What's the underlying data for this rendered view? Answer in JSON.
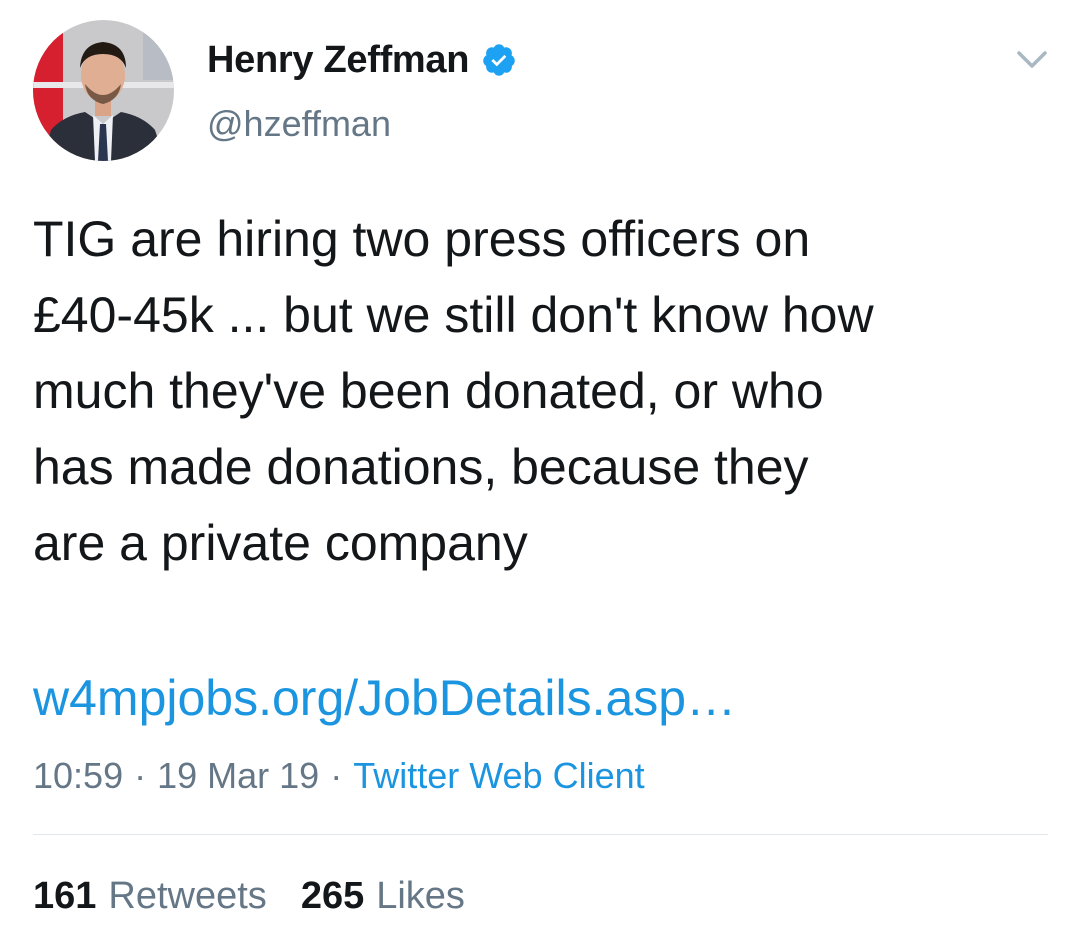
{
  "author": {
    "display_name": "Henry Zeffman",
    "handle": "@hzeffman",
    "verified": true,
    "avatar_icon": "profile-photo"
  },
  "tweet": {
    "text": "TIG are hiring two press officers on\n£40-45k ... but we still don't know how\nmuch they've been donated, or who\nhas made donations, because they\nare a private company",
    "link_text": "w4mpjobs.org/JobDetails.asp…",
    "time": "10:59",
    "separator": "·",
    "date": "19 Mar 19",
    "client": "Twitter Web Client"
  },
  "stats": {
    "retweets_count": "161",
    "retweets_label": "Retweets",
    "likes_count": "265",
    "likes_label": "Likes"
  },
  "colors": {
    "link": "#1b95e0",
    "secondary_text": "#657786",
    "primary_text": "#14171a",
    "verified_badge": "#1da1f2",
    "divider": "#e1e8ed"
  },
  "icons": {
    "verified": "verified-badge-icon",
    "menu": "chevron-down-icon"
  }
}
